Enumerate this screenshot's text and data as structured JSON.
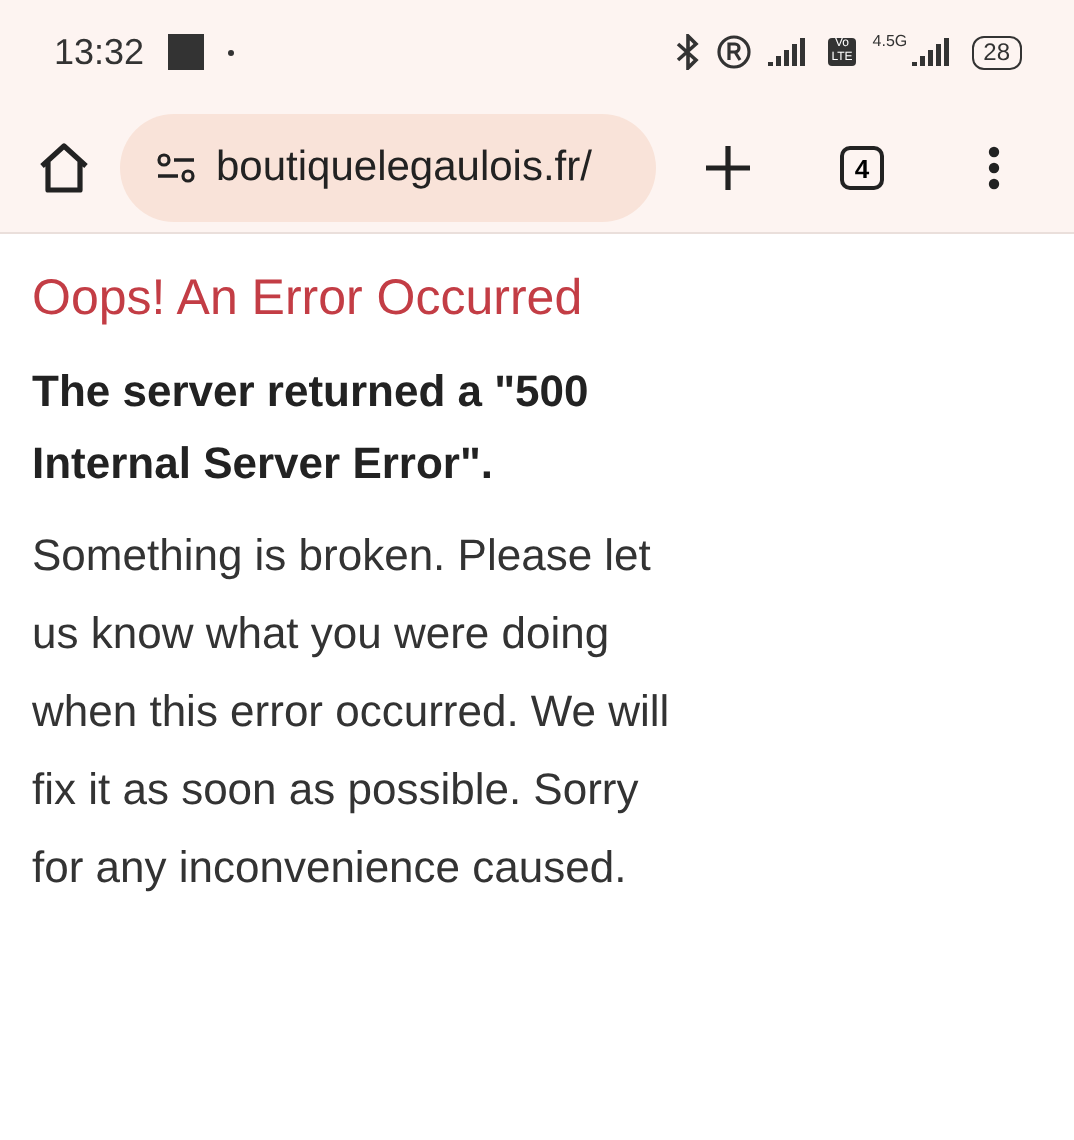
{
  "status_bar": {
    "time": "13:32",
    "volte_badge": [
      "Vo",
      "LTE"
    ],
    "network": "4.5G",
    "battery": "28"
  },
  "toolbar": {
    "url": "boutiquelegaulois.fr/",
    "tab_count": "4"
  },
  "page": {
    "heading": "Oops! An Error Occurred",
    "subheading": "The server returned a \"500 Internal Server Error\".",
    "message": "Something is broken. Please let us know what you were doing when this error occurred. We will fix it as soon as possible. Sorry for any inconvenience caused."
  }
}
